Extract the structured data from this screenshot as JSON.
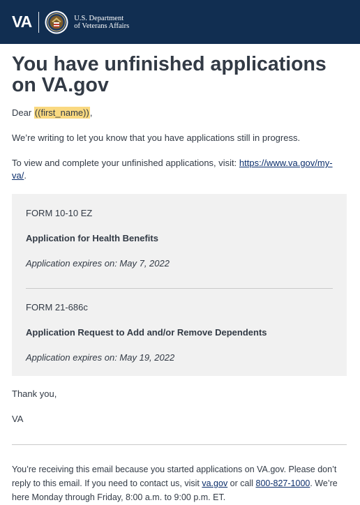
{
  "header": {
    "logo_text": "VA",
    "dept_line1": "U.S. Department",
    "dept_line2": "of Veterans Affairs",
    "bg_color": "#112e51"
  },
  "title": "You have unfinished applications on VA.gov",
  "greeting": {
    "dear": "Dear ",
    "placeholder": "((first_name))",
    "comma": ","
  },
  "intro": "We’re writing to let you know that you have applications still in progress.",
  "view": {
    "text": "To view and complete your unfinished applications, visit: ",
    "link": "https://www.va.gov/my-va/",
    "end": "."
  },
  "applications": [
    {
      "form": "FORM 10-10 EZ",
      "name": "Application for Health Benefits",
      "expires": "Application expires on: May 7, 2022"
    },
    {
      "form": "FORM 21-686c",
      "name": "Application Request to Add and/or Remove Dependents",
      "expires": "Application expires on: May 19, 2022"
    }
  ],
  "closing": {
    "thanks": "Thank you,",
    "sign": "VA"
  },
  "footer": {
    "t1": "You’re receiving this email because you started applications on VA.gov. Please don’t reply to this email. If you need to contact us, visit ",
    "link1": "va.gov",
    "t2": " or call ",
    "link2": "800-827-1000",
    "t3": ". We’re here Monday through Friday, 8:00 a.m. to 9:00 p.m. ET."
  },
  "colors": {
    "highlight": "#fad980",
    "box_bg": "#f1f1f1",
    "link": "#0b2e6b"
  }
}
